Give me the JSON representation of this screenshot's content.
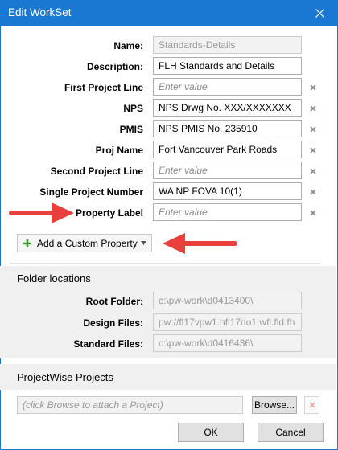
{
  "window": {
    "title": "Edit WorkSet"
  },
  "fields": [
    {
      "label": "Name:",
      "value": "Standards-Details",
      "state": "disabled",
      "clear": false
    },
    {
      "label": "Description:",
      "value": "FLH Standards and Details",
      "state": "value",
      "clear": false
    },
    {
      "label": "First Project Line",
      "value": "Enter value",
      "state": "placeholder",
      "clear": true
    },
    {
      "label": "NPS",
      "value": "NPS Drwg No. XXX/XXXXXXX",
      "state": "value",
      "clear": true
    },
    {
      "label": "PMIS",
      "value": "NPS PMIS No. 235910",
      "state": "value",
      "clear": true
    },
    {
      "label": "Proj Name",
      "value": "Fort Vancouver Park Roads",
      "state": "value",
      "clear": true
    },
    {
      "label": "Second Project Line",
      "value": "Enter value",
      "state": "placeholder",
      "clear": true
    },
    {
      "label": "Single Project Number",
      "value": "WA NP FOVA 10(1)",
      "state": "value",
      "clear": true
    },
    {
      "label": "Property Label",
      "value": "Enter value",
      "state": "placeholder",
      "clear": true
    }
  ],
  "add_property": {
    "label": "Add a Custom Property"
  },
  "folders": {
    "header": "Folder locations",
    "items": [
      {
        "label": "Root Folder:",
        "value": "c:\\pw-work\\d0413400\\"
      },
      {
        "label": "Design Files:",
        "value": "pw://fl17vpw1.hfl17do1.wfl.fld.fh"
      },
      {
        "label": "Standard Files:",
        "value": "c:\\pw-work\\d0416436\\"
      }
    ]
  },
  "projectwise": {
    "header": "ProjectWise Projects",
    "placeholder": "(click Browse to attach a Project)",
    "browse_label": "Browse..."
  },
  "footer": {
    "ok_label": "OK",
    "cancel_label": "Cancel"
  },
  "colors": {
    "titlebar": "#1b78d2",
    "annotation_arrow": "#e8403c",
    "plus_icon": "#3c9a2e"
  }
}
